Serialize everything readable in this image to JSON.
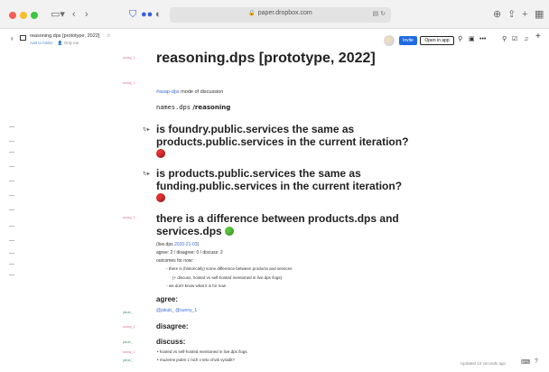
{
  "browser": {
    "url": "paper.dropbox.com",
    "icons": {
      "sidebar": "sidebar-icon",
      "back": "chevron-left-icon",
      "forward": "chevron-right-icon",
      "shield": "shield-icon",
      "dots": "extensions-icon",
      "privacy": "privacy-icon",
      "translate": "translate-icon",
      "reload": "reload-icon",
      "download": "download-icon",
      "share": "share-icon",
      "new_tab": "plus-icon",
      "tabs": "tab-overview-icon"
    }
  },
  "header": {
    "doc_title": "reasoning.dps [prototype, 2022]",
    "add_to_folder": "Add to folder",
    "only_me": "Only me",
    "invite": "Invite",
    "open_in_app": "Open in app"
  },
  "doc": {
    "gutter": {
      "title_author": "sunny_1",
      "tagline_author": "sunny_1",
      "diff_author": "sunny_1",
      "agree_author": "jakub_",
      "disagree_author": "sunny_1",
      "discuss_author": "jakub_",
      "hosted_author": "sunny_1",
      "muzeme_author": "jakub_"
    },
    "title": "reasoning.dps [prototype, 2022]",
    "tagline_tag": "#asap-dps",
    "tagline_rest": " mode of discussion",
    "names_mono": "names.dps",
    "names_bold": " /reasoning",
    "q1": "is foundry.public.services the same as products.public.services in the current iteration?",
    "q2": "is products.public.services the same as funding.public.services in the current iteration?",
    "h3": "there is a difference between products.dps and services.dps",
    "live_prefix": "(live.dps ",
    "live_date": "2020-21-03",
    "live_suffix": ")",
    "votes": "agree: 2 / disagree: 0 / discuss: 2",
    "outcomes": "outcomes for now:",
    "outcome1": "there is (historically) some difference between products and services",
    "outcome1b": "(+ discuss, hosted vs self-hosted mentioned in live.dps /logs)",
    "outcome2": "we don't know what it is for now",
    "agree": "agree:",
    "agree_mentions": "@jakub_ @sunny_1",
    "disagree": "disagree:",
    "discuss": "discuss:",
    "discuss1": "hosted vs self-hosted mentioned in live.dps /logs",
    "discuss2": "muzeme jeden z nich v teto chvili vyradit?"
  },
  "footer": {
    "updated": "Updated 10 seconds ago"
  }
}
